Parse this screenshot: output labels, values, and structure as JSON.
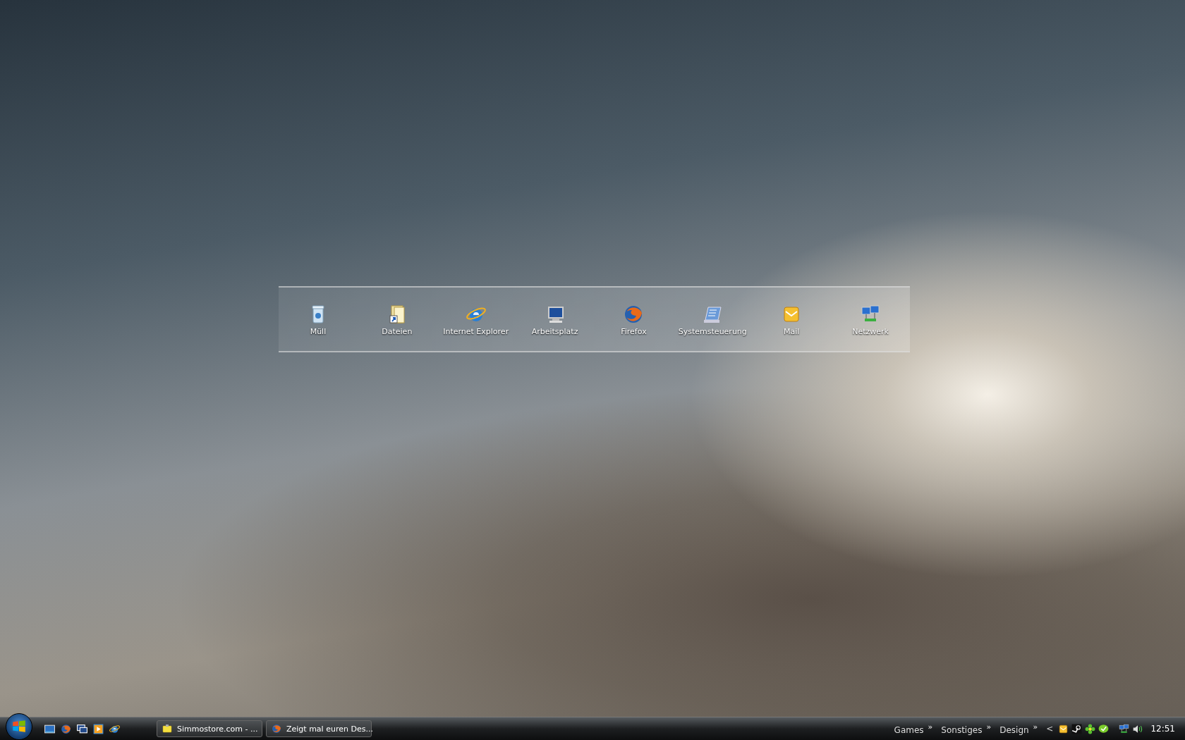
{
  "desktop_icons": [
    {
      "label": "Müll",
      "kind": "trash"
    },
    {
      "label": "Dateien",
      "kind": "folder"
    },
    {
      "label": "Internet Explorer",
      "kind": "ie"
    },
    {
      "label": "Arbeitsplatz",
      "kind": "computer"
    },
    {
      "label": "Firefox",
      "kind": "firefox"
    },
    {
      "label": "Systemsteuerung",
      "kind": "control"
    },
    {
      "label": "Mail",
      "kind": "mail"
    },
    {
      "label": "Netzwerk",
      "kind": "network"
    }
  ],
  "taskbar": {
    "quick_launch": [
      {
        "kind": "desktop"
      },
      {
        "kind": "firefox"
      },
      {
        "kind": "windows"
      },
      {
        "kind": "media"
      },
      {
        "kind": "ie"
      }
    ],
    "windows": [
      {
        "label": "Simmostore.com - ...",
        "kind": "note"
      },
      {
        "label": "Zeigt mal euren Des...",
        "kind": "firefox"
      }
    ],
    "toolbars": [
      {
        "label": "Games",
        "chevron": "»"
      },
      {
        "label": "Sonstiges",
        "chevron": "»"
      },
      {
        "label": "Design",
        "chevron": "»"
      }
    ],
    "tray": {
      "expand": "<",
      "icons": [
        {
          "kind": "mail"
        },
        {
          "kind": "steam"
        },
        {
          "kind": "flower"
        },
        {
          "kind": "chat"
        },
        {
          "kind": "network"
        },
        {
          "kind": "volume"
        }
      ],
      "clock": "12:51"
    }
  }
}
